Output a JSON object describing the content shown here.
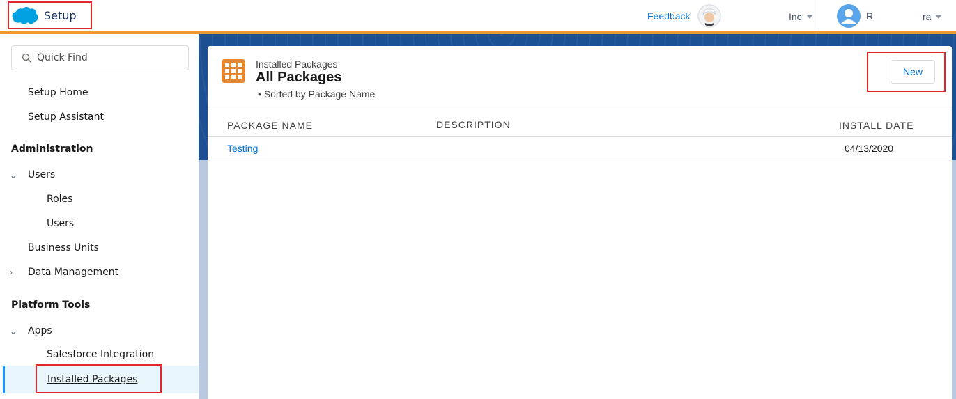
{
  "header": {
    "app_name": "Setup",
    "feedback_label": "Feedback",
    "org_label": "Inc",
    "user_initial": "R",
    "user_menu_label": "ra"
  },
  "sidebar": {
    "quick_find_placeholder": "Quick Find",
    "items": {
      "setup_home": "Setup Home",
      "setup_assistant": "Setup Assistant",
      "administration": "Administration",
      "users_group": "Users",
      "roles": "Roles",
      "users": "Users",
      "business_units": "Business Units",
      "data_management": "Data Management",
      "platform_tools": "Platform Tools",
      "apps": "Apps",
      "salesforce_integration": "Salesforce Integration",
      "installed_packages": "Installed Packages"
    }
  },
  "main": {
    "eyebrow": "Installed Packages",
    "title": "All Packages",
    "sort_info": "Sorted by Package Name",
    "new_button": "New",
    "columns": [
      "PACKAGE NAME",
      "DESCRIPTION",
      "INSTALL DATE"
    ],
    "rows": [
      {
        "package_name": "Testing",
        "description": "",
        "install_date": "04/13/2020"
      }
    ]
  },
  "colors": {
    "brand_blue": "#00a1e0",
    "accent_orange": "#f19b2c",
    "highlight_red": "#e3262b",
    "link_blue": "#0070d2"
  }
}
